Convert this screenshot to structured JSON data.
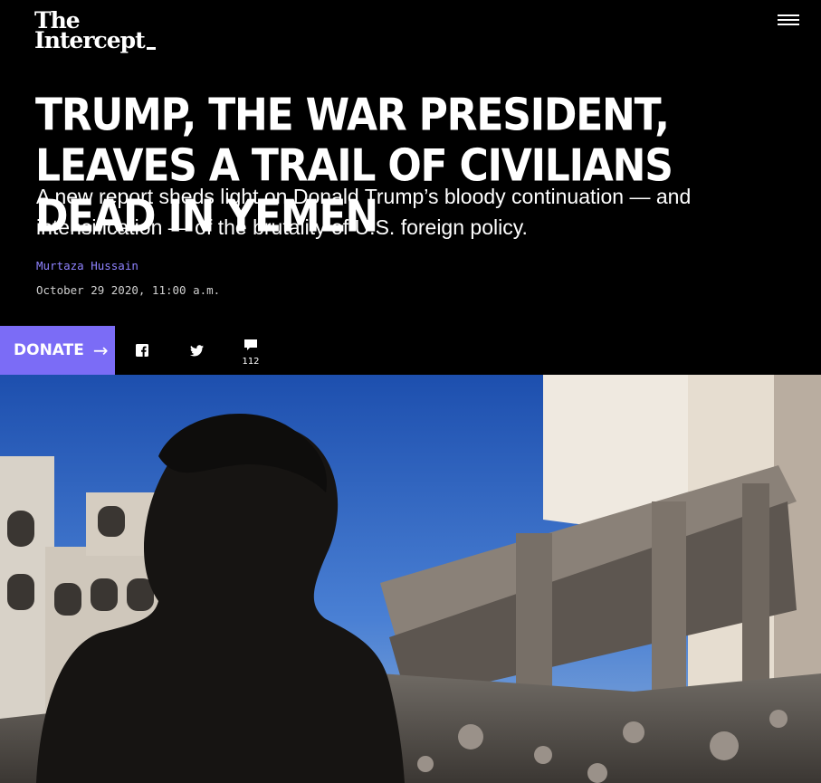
{
  "header": {
    "logo_line1": "The",
    "logo_line2": "Intercept",
    "menu_icon": "hamburger-menu-icon"
  },
  "article": {
    "headline": "TRUMP, THE WAR PRESIDENT, LEAVES A TRAIL OF CIVILIANS DEAD IN YEMEN",
    "dek": "A new report sheds light on Donald Trump’s bloody continuation — and intensification — of the brutality of U.S. foreign policy.",
    "author": "Murtaza Hussain",
    "date": "October 29 2020, 11:00 a.m."
  },
  "share": {
    "donate_label": "DONATE",
    "donate_arrow": "→",
    "facebook_icon": "facebook-icon",
    "twitter_icon": "twitter-icon",
    "comment_icon": "comment-icon",
    "comment_count": "112"
  },
  "colors": {
    "background": "#000000",
    "accent": "#7b6cf6",
    "byline": "#8f83ff"
  }
}
